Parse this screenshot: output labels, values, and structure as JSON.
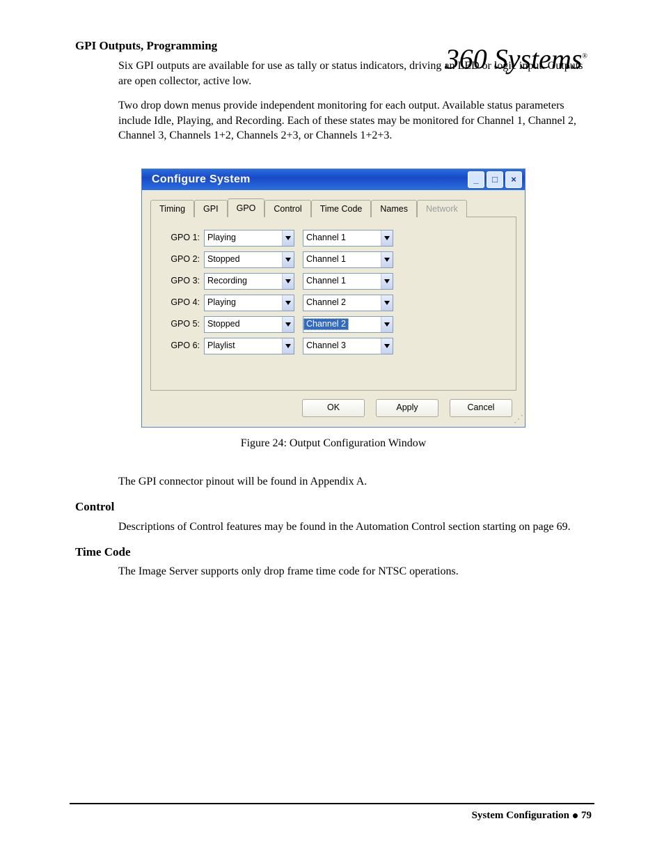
{
  "logo_text": "360 Systems",
  "sections": {
    "gpi": {
      "heading": "GPI Outputs, Programming",
      "p1": "Six GPI outputs are available for use as tally or status indicators, driving an LED or logic input. Outputs are open collector, active low.",
      "p2": "Two drop down menus provide independent monitoring for each output.  Available status parameters include Idle, Playing, and Recording.  Each of these states may be monitored for Channel 1, Channel 2, Channel 3, Channels 1+2, Channels 2+3, or Channels 1+2+3."
    },
    "caption": "Figure 24:  Output Configuration Window",
    "after_caption": "The GPI connector pinout will be found in Appendix A.",
    "control": {
      "heading": "Control",
      "p1": "Descriptions of Control features may be found in the Automation Control section starting on page 69."
    },
    "timecode": {
      "heading": "Time Code",
      "p1": "The Image Server supports only drop frame time code for NTSC operations."
    }
  },
  "window": {
    "title": "Configure System",
    "tabs": [
      "Timing",
      "GPI",
      "GPO",
      "Control",
      "Time Code",
      "Names",
      "Network"
    ],
    "active_tab": "GPO",
    "disabled_tab": "Network",
    "rows": [
      {
        "label": "GPO 1:",
        "status": "Playing",
        "channel": "Channel 1",
        "selected": false
      },
      {
        "label": "GPO 2:",
        "status": "Stopped",
        "channel": "Channel 1",
        "selected": false
      },
      {
        "label": "GPO 3:",
        "status": "Recording",
        "channel": "Channel 1",
        "selected": false
      },
      {
        "label": "GPO 4:",
        "status": "Playing",
        "channel": "Channel 2",
        "selected": false
      },
      {
        "label": "GPO 5:",
        "status": "Stopped",
        "channel": "Channel 2",
        "selected": true
      },
      {
        "label": "GPO 6:",
        "status": "Playlist",
        "channel": "Channel 3",
        "selected": false
      }
    ],
    "buttons": {
      "ok": "OK",
      "apply": "Apply",
      "cancel": "Cancel"
    }
  },
  "footer": {
    "section": "System Configuration",
    "page": "79"
  }
}
